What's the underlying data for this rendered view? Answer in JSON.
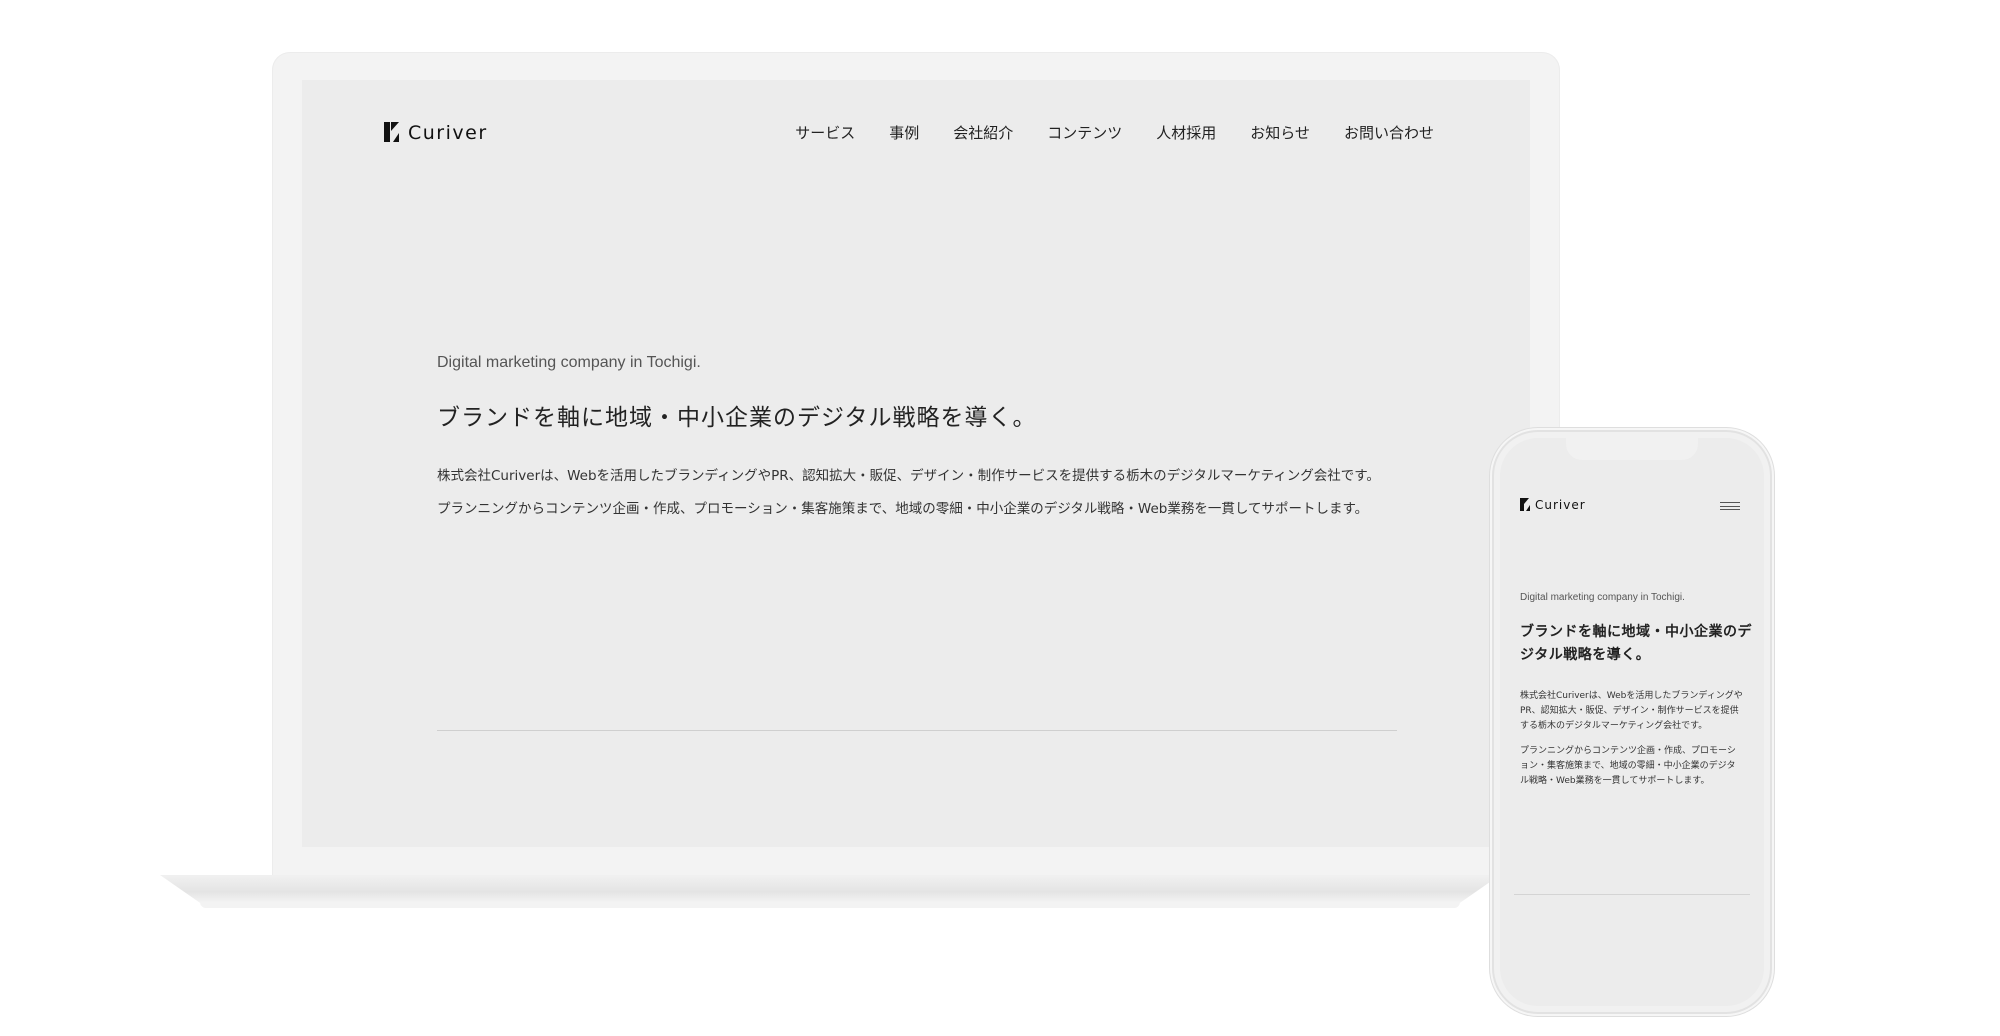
{
  "brand": {
    "name": "Curiver"
  },
  "nav": {
    "items": [
      {
        "label": "サービス"
      },
      {
        "label": "事例"
      },
      {
        "label": "会社紹介"
      },
      {
        "label": "コンテンツ"
      },
      {
        "label": "人材採用"
      },
      {
        "label": "お知らせ"
      },
      {
        "label": "お問い合わせ"
      }
    ]
  },
  "hero": {
    "tagline": "Digital marketing company in Tochigi.",
    "headline": "ブランドを軸に地域・中小企業のデジタル戦略を導く。",
    "body_line1": "株式会社Curiverは、Webを活用したブランディングやPR、認知拡大・販促、デザイン・制作サービスを提供する栃木のデジタルマーケティング会社です。",
    "body_line2": "プランニングからコンテンツ企画・作成、プロモーション・集客施策まで、地域の零細・中小企業のデジタル戦略・Web業務を一貫してサポートします。"
  },
  "mobile": {
    "headline_line1": "ブランドを軸に地域・中小企業のデ",
    "headline_line2": "ジタル戦略を導く。",
    "p1_line1": "株式会社Curiverは、Webを活用したブランディングや",
    "p1_line2": "PR、認知拡大・販促、デザイン・制作サービスを提供",
    "p1_line3": "する栃木のデジタルマーケティング会社です。",
    "p2_line1": "プランニングからコンテンツ企画・作成、プロモーシ",
    "p2_line2": "ョン・集客施策まで、地域の零細・中小企業のデジタ",
    "p2_line3": "ル戦略・Web業務を一貫してサポートします。"
  },
  "icons": {
    "logo": "curiver-logo-mark",
    "menu": "hamburger-menu-icon"
  },
  "colors": {
    "background": "#ffffff",
    "screen": "#ececec",
    "text": "#222222"
  }
}
